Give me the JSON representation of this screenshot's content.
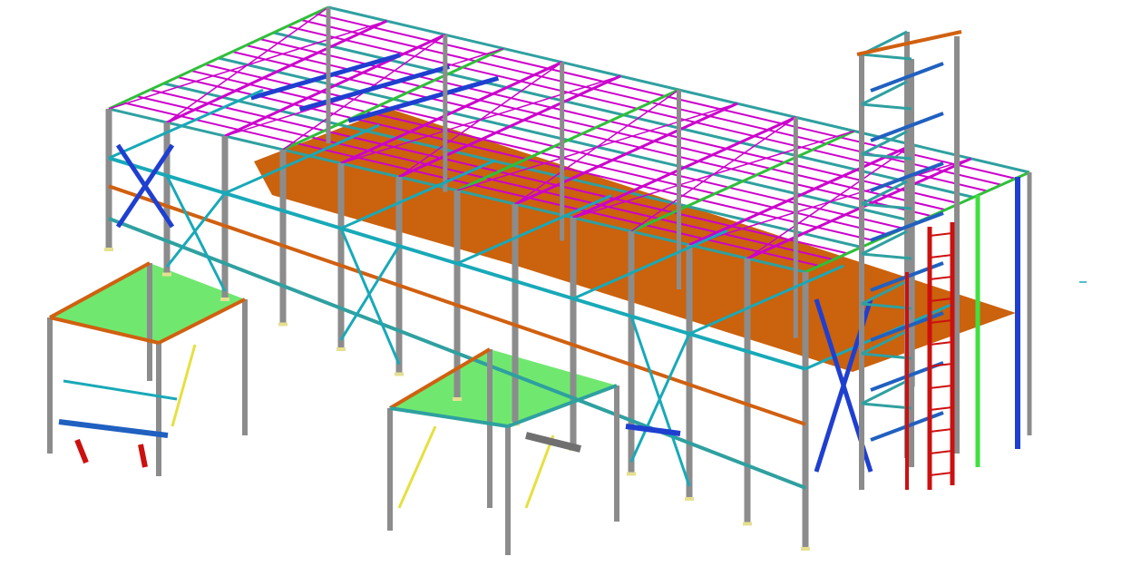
{
  "palette": {
    "background": "#ffffff",
    "column": "#8c8c8c",
    "roof_purlin": "#cc00cc",
    "roof_truss": "#2fbf3a",
    "bracing": "#1f3fd0",
    "beam_cyan": "#18a9b8",
    "beam_teal": "#2fa0a0",
    "beam_orange": "#d06010",
    "floor_deck": "#c85a00",
    "platform_green": "#40e040",
    "stair_blue": "#2060c0",
    "ladder_red": "#cc1010",
    "handrail_yellow": "#e6e040",
    "column_base": "#e6e090",
    "stair_tower_grey": "#707070"
  },
  "model": {
    "kind": "3d-structural-steel-model",
    "components": [
      "main-frame-columns",
      "roof-framing",
      "roof-bracing",
      "mezzanine-floor-deck",
      "left-platform",
      "front-platform",
      "stair-tower",
      "caged-ladder",
      "vertical-bracing"
    ]
  }
}
